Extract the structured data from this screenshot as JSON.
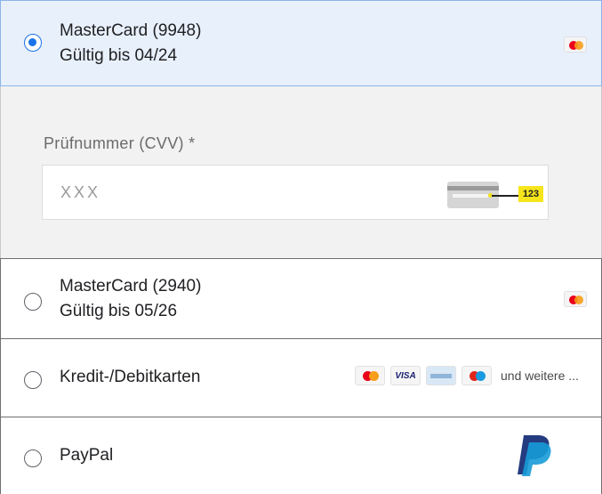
{
  "payment_options": [
    {
      "id": "mc-9948",
      "title": "MasterCard (9948)",
      "subtitle": "Gültig bis 04/24",
      "selected": true,
      "icon": "mastercard-icon"
    },
    {
      "id": "mc-2940",
      "title": "MasterCard (2940)",
      "subtitle": "Gültig bis 05/26",
      "selected": false,
      "icon": "mastercard-icon"
    },
    {
      "id": "cards",
      "title": "Kredit-/Debitkarten",
      "selected": false,
      "logos": [
        "mastercard-icon",
        "visa-icon",
        "amex-icon",
        "maestro-icon"
      ],
      "visa_text": "VISA",
      "more_label": "und weitere ..."
    },
    {
      "id": "paypal",
      "title": "PayPal",
      "selected": false,
      "icon": "paypal-icon"
    }
  ],
  "cvv": {
    "label": "Prüfnummer (CVV) *",
    "placeholder": "XXX",
    "value": "",
    "hint_badge": "123"
  },
  "colors": {
    "selected_bg": "#e8f0fc",
    "selected_border": "#8ab4e8",
    "radio_accent": "#1a73e8",
    "cvv_area_bg": "#f2f2f2",
    "hint_yellow": "#f7e51c",
    "paypal_dark": "#253b80",
    "paypal_light": "#179bd7"
  }
}
